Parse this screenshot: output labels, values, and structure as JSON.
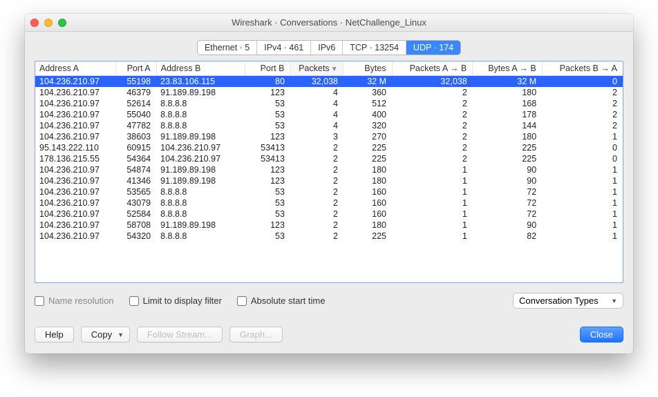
{
  "window": {
    "title": "Wireshark · Conversations · NetChallenge_Linux"
  },
  "tabs": [
    {
      "label": "Ethernet · 5",
      "active": false
    },
    {
      "label": "IPv4 · 461",
      "active": false
    },
    {
      "label": "IPv6",
      "active": false
    },
    {
      "label": "TCP · 13254",
      "active": false
    },
    {
      "label": "UDP · 174",
      "active": true
    }
  ],
  "columns": [
    {
      "label": "Address A",
      "numeric": false
    },
    {
      "label": "Port A",
      "numeric": true
    },
    {
      "label": "Address B",
      "numeric": false
    },
    {
      "label": "Port B",
      "numeric": true
    },
    {
      "label": "Packets",
      "numeric": true,
      "sorted": true
    },
    {
      "label": "Bytes",
      "numeric": true
    },
    {
      "label": "Packets A → B",
      "numeric": true
    },
    {
      "label": "Bytes A → B",
      "numeric": true
    },
    {
      "label": "Packets B → A",
      "numeric": true
    }
  ],
  "rows": [
    [
      "104.236.210.97",
      "55198",
      "23.83.106.115",
      "80",
      "32,038",
      "32 M",
      "32,038",
      "32 M",
      "0"
    ],
    [
      "104.236.210.97",
      "46379",
      "91.189.89.198",
      "123",
      "4",
      "360",
      "2",
      "180",
      "2"
    ],
    [
      "104.236.210.97",
      "52614",
      "8.8.8.8",
      "53",
      "4",
      "512",
      "2",
      "168",
      "2"
    ],
    [
      "104.236.210.97",
      "55040",
      "8.8.8.8",
      "53",
      "4",
      "400",
      "2",
      "178",
      "2"
    ],
    [
      "104.236.210.97",
      "47782",
      "8.8.8.8",
      "53",
      "4",
      "320",
      "2",
      "144",
      "2"
    ],
    [
      "104.236.210.97",
      "38603",
      "91.189.89.198",
      "123",
      "3",
      "270",
      "2",
      "180",
      "1"
    ],
    [
      "95.143.222.110",
      "60915",
      "104.236.210.97",
      "53413",
      "2",
      "225",
      "2",
      "225",
      "0"
    ],
    [
      "178.136.215.55",
      "54364",
      "104.236.210.97",
      "53413",
      "2",
      "225",
      "2",
      "225",
      "0"
    ],
    [
      "104.236.210.97",
      "54874",
      "91.189.89.198",
      "123",
      "2",
      "180",
      "1",
      "90",
      "1"
    ],
    [
      "104.236.210.97",
      "41346",
      "91.189.89.198",
      "123",
      "2",
      "180",
      "1",
      "90",
      "1"
    ],
    [
      "104.236.210.97",
      "53565",
      "8.8.8.8",
      "53",
      "2",
      "160",
      "1",
      "72",
      "1"
    ],
    [
      "104.236.210.97",
      "43079",
      "8.8.8.8",
      "53",
      "2",
      "160",
      "1",
      "72",
      "1"
    ],
    [
      "104.236.210.97",
      "52584",
      "8.8.8.8",
      "53",
      "2",
      "160",
      "1",
      "72",
      "1"
    ],
    [
      "104.236.210.97",
      "58708",
      "91.189.89.198",
      "123",
      "2",
      "180",
      "1",
      "90",
      "1"
    ],
    [
      "104.236.210.97",
      "54320",
      "8.8.8.8",
      "53",
      "2",
      "225",
      "1",
      "82",
      "1"
    ]
  ],
  "options": {
    "name_resolution": "Name resolution",
    "limit_filter": "Limit to display filter",
    "absolute_time": "Absolute start time",
    "conv_types": "Conversation Types"
  },
  "buttons": {
    "help": "Help",
    "copy": "Copy",
    "follow": "Follow Stream...",
    "graph": "Graph...",
    "close": "Close"
  }
}
